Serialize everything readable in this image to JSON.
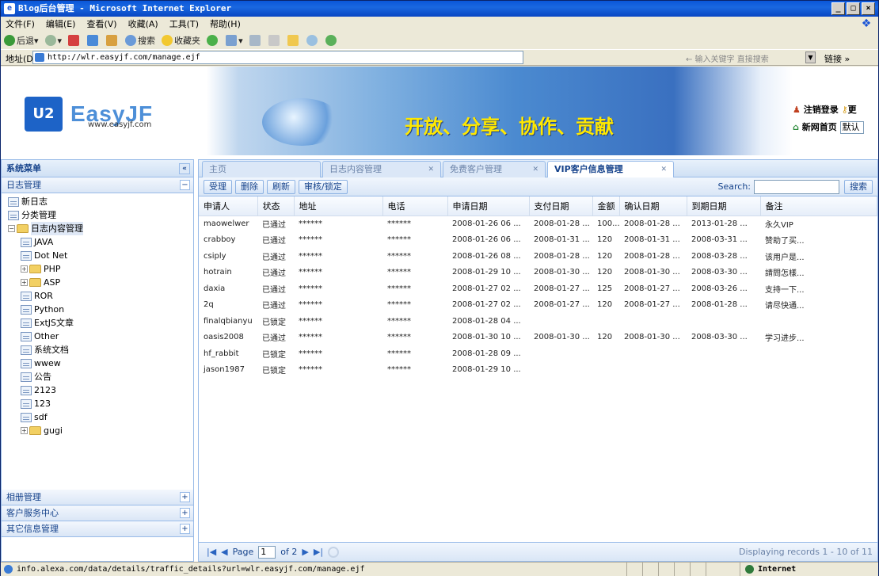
{
  "window": {
    "title": "Blog后台管理 - Microsoft Internet Explorer",
    "controls": [
      "_",
      "□",
      "×"
    ]
  },
  "menu": [
    "文件(F)",
    "编辑(E)",
    "查看(V)",
    "收藏(A)",
    "工具(T)",
    "帮助(H)"
  ],
  "toolbar": {
    "back": "后退",
    "search": "搜索",
    "favorites": "收藏夹"
  },
  "address": {
    "label": "地址(D)",
    "url": "http://wlr.easyjf.com/manage.ejf",
    "search_hint": "← 输入关键字 直接搜索",
    "go": "链接 »"
  },
  "banner": {
    "logo_mark": "U2",
    "brand": "EasyJF",
    "site": "www.easyjf.com",
    "slogan": "开放、分享、协作、贡献",
    "link1": "注销登录",
    "link1b": "更",
    "link2": "新网首页",
    "default_value": "默认"
  },
  "sidebar": {
    "title": "系统菜单",
    "collapse": "«",
    "section_open": "日志管理",
    "tree": [
      {
        "label": "新日志",
        "type": "leaf",
        "depth": 0
      },
      {
        "label": "分类管理",
        "type": "leaf",
        "depth": 0
      },
      {
        "label": "日志内容管理",
        "type": "folder-open",
        "depth": 0
      },
      {
        "label": "JAVA",
        "type": "leaf",
        "depth": 1
      },
      {
        "label": "Dot Net",
        "type": "leaf",
        "depth": 1
      },
      {
        "label": "PHP",
        "type": "folder",
        "depth": 1
      },
      {
        "label": "ASP",
        "type": "folder",
        "depth": 1
      },
      {
        "label": "ROR",
        "type": "leaf",
        "depth": 1
      },
      {
        "label": "Python",
        "type": "leaf",
        "depth": 1
      },
      {
        "label": "ExtJS文章",
        "type": "leaf",
        "depth": 1
      },
      {
        "label": "Other",
        "type": "leaf",
        "depth": 1
      },
      {
        "label": "系统文档",
        "type": "leaf",
        "depth": 1
      },
      {
        "label": "wwew",
        "type": "leaf",
        "depth": 1
      },
      {
        "label": "公告",
        "type": "leaf",
        "depth": 1
      },
      {
        "label": "2123",
        "type": "leaf",
        "depth": 1
      },
      {
        "label": "123",
        "type": "leaf",
        "depth": 1
      },
      {
        "label": "sdf",
        "type": "leaf",
        "depth": 1
      },
      {
        "label": "gugi",
        "type": "folder",
        "depth": 1
      }
    ],
    "sections_closed": [
      "相册管理",
      "客户服务中心",
      "其它信息管理"
    ]
  },
  "tabs": [
    {
      "label": "主页",
      "active": false,
      "closable": false
    },
    {
      "label": "日志内容管理",
      "active": false,
      "closable": true
    },
    {
      "label": "免费客户管理",
      "active": false,
      "closable": true
    },
    {
      "label": "VIP客户信息管理",
      "active": true,
      "closable": true
    }
  ],
  "grid": {
    "buttons": [
      "受理",
      "删除",
      "刷新",
      "审核/锁定"
    ],
    "search_label": "Search:",
    "search_button": "搜索",
    "columns": [
      "申请人",
      "状态",
      "地址",
      "电话",
      "申请日期",
      "支付日期",
      "金额",
      "确认日期",
      "到期日期",
      "备注"
    ],
    "rows": [
      [
        "maowelwer",
        "已通过",
        "******",
        "******",
        "2008-01-26 06 ...",
        "2008-01-28 ...",
        "100...",
        "2008-01-28 ...",
        "2013-01-28 ...",
        "永久VIP"
      ],
      [
        "crabboy",
        "已通过",
        "******",
        "******",
        "2008-01-26 06 ...",
        "2008-01-31 ...",
        "120",
        "2008-01-31 ...",
        "2008-03-31 ...",
        "赞助了买..."
      ],
      [
        "csiply",
        "已通过",
        "******",
        "******",
        "2008-01-26 08 ...",
        "2008-01-28 ...",
        "120",
        "2008-01-28 ...",
        "2008-03-28 ...",
        "该用户是..."
      ],
      [
        "hotrain",
        "已通过",
        "******",
        "******",
        "2008-01-29 10 ...",
        "2008-01-30 ...",
        "120",
        "2008-01-30 ...",
        "2008-03-30 ...",
        "請問怎樣..."
      ],
      [
        "daxia",
        "已通过",
        "******",
        "******",
        "2008-01-27 02 ...",
        "2008-01-27 ...",
        "125",
        "2008-01-27 ...",
        "2008-03-26 ...",
        "支持一下..."
      ],
      [
        "2q",
        "已通过",
        "******",
        "******",
        "2008-01-27 02 ...",
        "2008-01-27 ...",
        "120",
        "2008-01-27 ...",
        "2008-01-28 ...",
        "请尽快通..."
      ],
      [
        "finalqbianyu",
        "已锁定",
        "******",
        "******",
        "2008-01-28 04 ...",
        "",
        "",
        "",
        "",
        ""
      ],
      [
        "oasis2008",
        "已通过",
        "******",
        "******",
        "2008-01-30 10 ...",
        "2008-01-30 ...",
        "120",
        "2008-01-30 ...",
        "2008-03-30 ...",
        "学习进步..."
      ],
      [
        "hf_rabbit",
        "已锁定",
        "******",
        "******",
        "2008-01-28 09 ...",
        "",
        "",
        "",
        "",
        ""
      ],
      [
        "jason1987",
        "已锁定",
        "******",
        "******",
        "2008-01-29 10 ...",
        "",
        "",
        "",
        "",
        ""
      ]
    ]
  },
  "pager": {
    "page_label": "Page",
    "page_value": "1",
    "of_label": "of 2",
    "display": "Displaying records 1 - 10 of 11"
  },
  "status": {
    "text": "info.alexa.com/data/details/traffic_details?url=wlr.easyjf.com/manage.ejf",
    "zone": "Internet"
  }
}
